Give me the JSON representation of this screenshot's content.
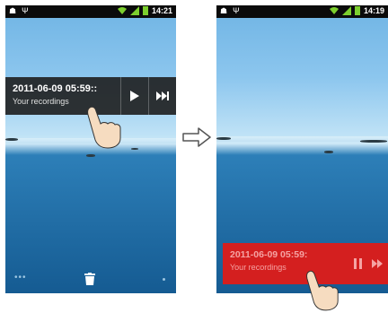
{
  "left_screen": {
    "status": {
      "left_icons": [
        "usb-debug-icon",
        "usb-icon"
      ],
      "time": "14:21"
    },
    "player": {
      "title": "2011-06-09 05:59::",
      "subtitle": "Your recordings",
      "buttons": [
        "play",
        "next"
      ]
    },
    "bottom": {
      "menu": "•••",
      "icons": [
        "trash-icon"
      ]
    }
  },
  "right_screen": {
    "status": {
      "left_icons": [
        "usb-debug-icon",
        "usb-icon"
      ],
      "time": "14:19"
    },
    "player": {
      "title": "2011-06-09 05:59:",
      "subtitle": "Your recordings",
      "buttons": [
        "pause",
        "next"
      ]
    }
  },
  "colors": {
    "player_dark": "#1e1e1e",
    "player_active_red": "#d41f1f",
    "sky": "#6fb4e4",
    "sea": "#155b92"
  }
}
